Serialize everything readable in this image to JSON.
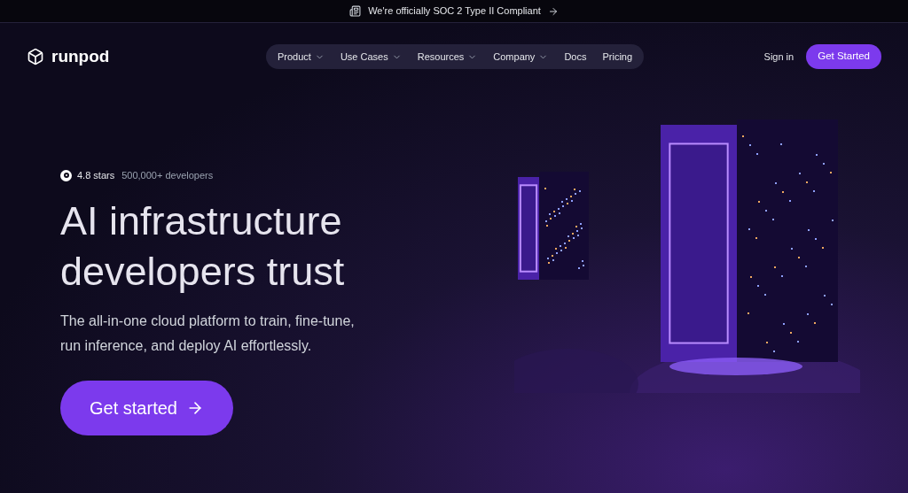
{
  "announcement": {
    "text": "We're officially SOC 2 Type II Compliant"
  },
  "header": {
    "logo": "runpod",
    "nav": [
      {
        "label": "Product",
        "kind": "menu"
      },
      {
        "label": "Use Cases",
        "kind": "menu"
      },
      {
        "label": "Resources",
        "kind": "menu"
      },
      {
        "label": "Company",
        "kind": "menu"
      },
      {
        "label": "Docs",
        "kind": "link"
      },
      {
        "label": "Pricing",
        "kind": "link"
      }
    ],
    "sign_in": "Sign in",
    "cta": "Get Started"
  },
  "hero": {
    "rating": "4.8 stars",
    "developers": "500,000+ developers",
    "title_lines": [
      "AI infrastructure",
      "developers trust"
    ],
    "subtitle": "The all-in-one cloud platform to train, fine-tune, run inference, and deploy AI effortlessly.",
    "cta": "Get started"
  }
}
